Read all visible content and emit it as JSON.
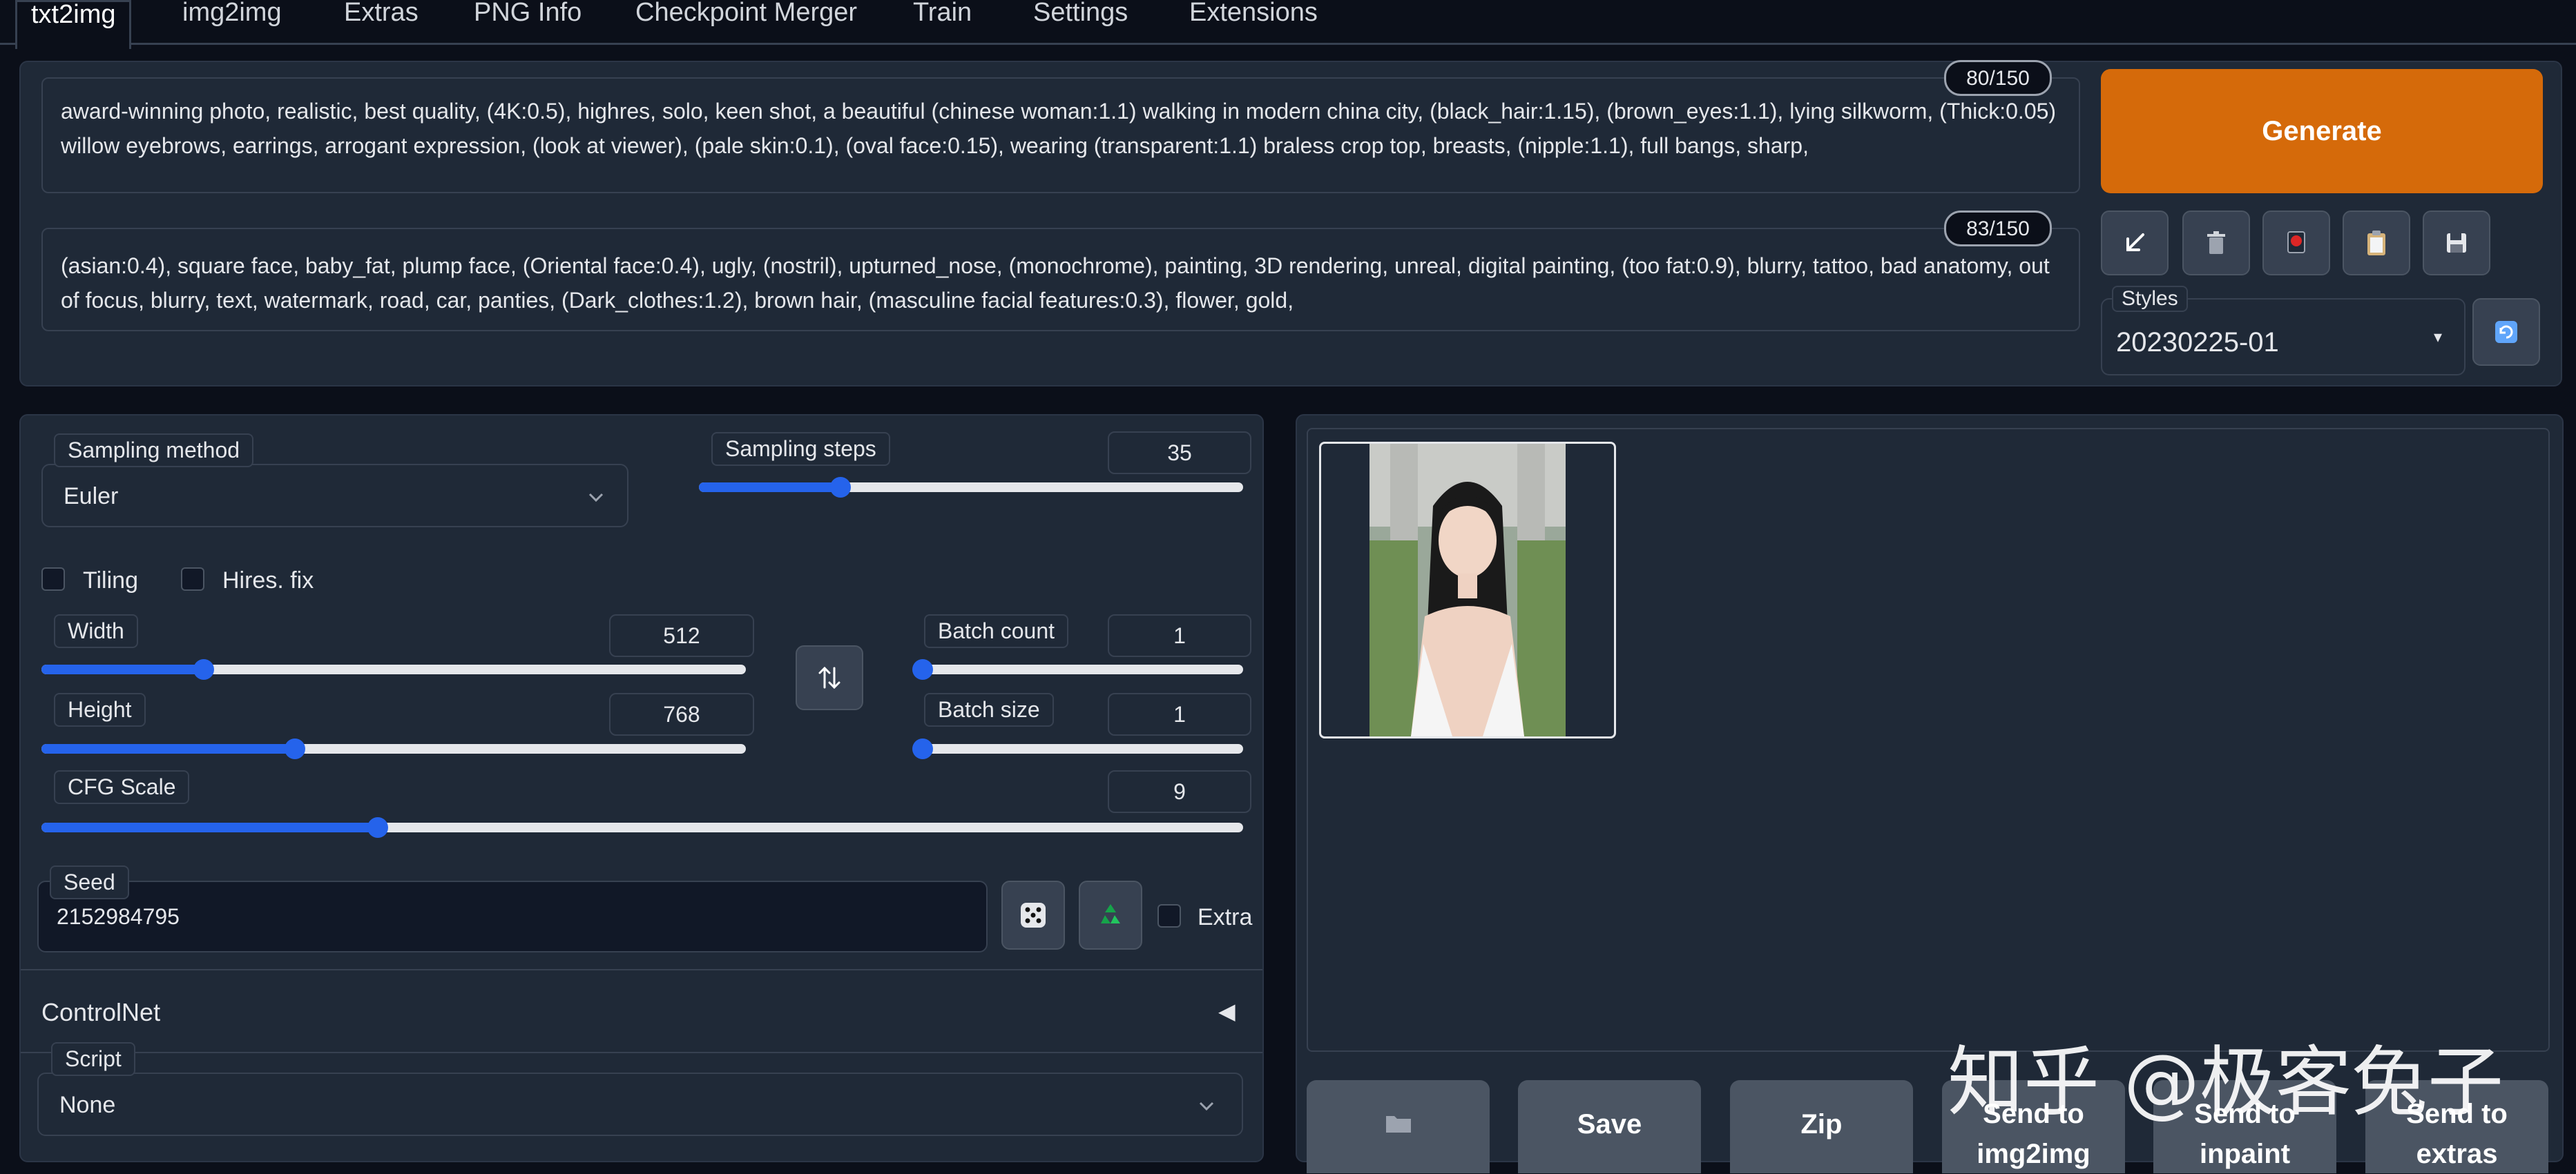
{
  "tabs": [
    {
      "label": "txt2img"
    },
    {
      "label": "img2img"
    },
    {
      "label": "Extras"
    },
    {
      "label": "PNG Info"
    },
    {
      "label": "Checkpoint Merger"
    },
    {
      "label": "Train"
    },
    {
      "label": "Settings"
    },
    {
      "label": "Extensions"
    }
  ],
  "prompt": {
    "text": "award-winning photo, realistic, best quality, (4K:0.5), highres, solo, keen shot, a beautiful (chinese woman:1.1) walking in modern china city, (black_hair:1.15), (brown_eyes:1.1), lying silkworm, (Thick:0.05) willow eyebrows, earrings, arrogant expression, (look at viewer), (pale skin:0.1), (oval face:0.15), wearing (transparent:1.1) braless crop top, breasts, (nipple:1.1), full bangs, sharp,",
    "token_count": "80/150"
  },
  "negative_prompt": {
    "text": "(asian:0.4), square face, baby_fat, plump face, (Oriental face:0.4), ugly, (nostril), upturned_nose, (monochrome), painting, 3D rendering, unreal, digital painting, (too fat:0.9), blurry, tattoo, bad anatomy, out of focus, blurry, text, watermark, road, car, panties, (Dark_clothes:1.2), brown hair, (masculine facial features:0.3), flower, gold,",
    "token_count": "83/150"
  },
  "generate_label": "Generate",
  "toolbar_icons": [
    "arrow-down-left-icon",
    "trash-icon",
    "flag-icon",
    "clipboard-icon",
    "floppy-disk-icon"
  ],
  "styles": {
    "label": "Styles",
    "value": "20230225-01",
    "refresh_icon": "refresh-icon"
  },
  "sampling_method": {
    "label": "Sampling method",
    "value": "Euler"
  },
  "sampling_steps": {
    "label": "Sampling steps",
    "value": "35",
    "level": 0.26
  },
  "tiling": {
    "label": "Tiling",
    "checked": false
  },
  "hires_fix": {
    "label": "Hires. fix",
    "checked": false
  },
  "width": {
    "label": "Width",
    "value": "512",
    "level": 0.23
  },
  "height": {
    "label": "Height",
    "value": "768",
    "level": 0.36
  },
  "batch_count": {
    "label": "Batch count",
    "value": "1",
    "level": 0.0
  },
  "batch_size": {
    "label": "Batch size",
    "value": "1",
    "level": 0.0
  },
  "cfg_scale": {
    "label": "CFG Scale",
    "value": "9",
    "level": 0.28
  },
  "seed": {
    "label": "Seed",
    "value": "2152984795",
    "extra_label": "Extra"
  },
  "controlnet": {
    "label": "ControlNet"
  },
  "script": {
    "label": "Script",
    "value": "None"
  },
  "output_buttons": [
    {
      "label": ""
    },
    {
      "label": "Save"
    },
    {
      "label": "Zip"
    },
    {
      "label": "Send to img2img"
    },
    {
      "label": "Send to inpaint"
    },
    {
      "label": "Send to extras"
    }
  ],
  "watermark": "知乎 @极客兔子",
  "colors": {
    "accent": "#2563eb",
    "generate": "#d56a0a",
    "panel": "#1f2937",
    "background": "#0b0f19"
  }
}
